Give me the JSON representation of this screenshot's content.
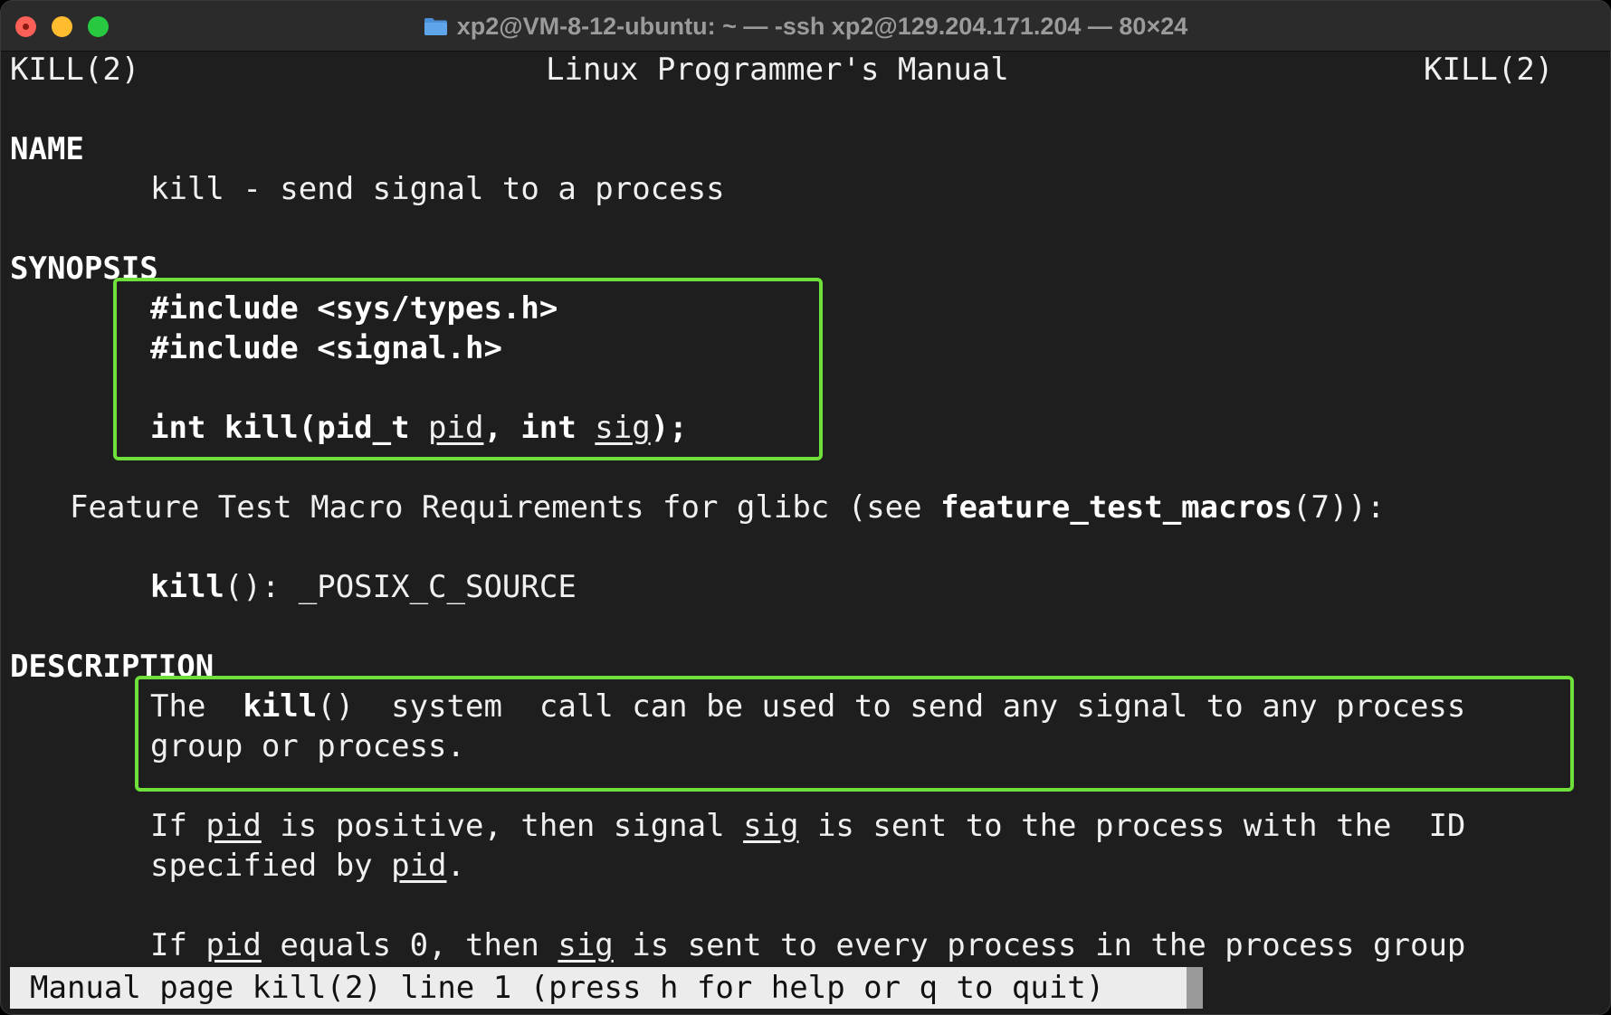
{
  "window": {
    "title": "xp2@VM-8-12-ubuntu: ~ — -ssh xp2@129.204.171.204 — 80×24",
    "title_icon": "folder-icon"
  },
  "colors": {
    "background": "#1e1e1e",
    "highlight_box": "#6fe03a",
    "status_bar": "#ececec"
  },
  "man": {
    "header_left": "KILL(2)",
    "header_center": "Linux Programmer's Manual",
    "header_right": "KILL(2)",
    "name_heading": "NAME",
    "name_line": "kill - send signal to a process",
    "synopsis_heading": "SYNOPSIS",
    "include1": "#include <sys/types.h>",
    "include2": "#include <signal.h>",
    "proto_int": "int kill(pid_t ",
    "proto_pid": "pid",
    "proto_comma": ", int ",
    "proto_sig": "sig",
    "proto_end": ");",
    "ftm_prefix": "Feature Test Macro Requirements for glibc (see ",
    "ftm_bold": "feature_test_macros",
    "ftm_suffix": "(7)):",
    "ftm_func": "kill",
    "ftm_rest": "(): _POSIX_C_SOURCE",
    "description_heading": "DESCRIPTION",
    "desc1_a": "The  ",
    "desc1_bold": "kill",
    "desc1_b": "()  system  call can be used to send any signal to any process",
    "desc2": "group or process.",
    "p2_a": "If ",
    "p2_pid": "pid",
    "p2_b": " is positive, then signal ",
    "p2_sig": "sig",
    "p2_c": " is sent to the process with the  ID",
    "p2_line2_a": "specified by ",
    "p2_line2_pid": "pid",
    "p2_line2_b": ".",
    "p3_a": "If ",
    "p3_pid": "pid",
    "p3_b": " equals 0, then ",
    "p3_sig": "sig",
    "p3_c": " is sent to every process in the process group"
  },
  "status_bar": {
    "text": "Manual page kill(2) line 1 (press h for help or q to quit)"
  }
}
